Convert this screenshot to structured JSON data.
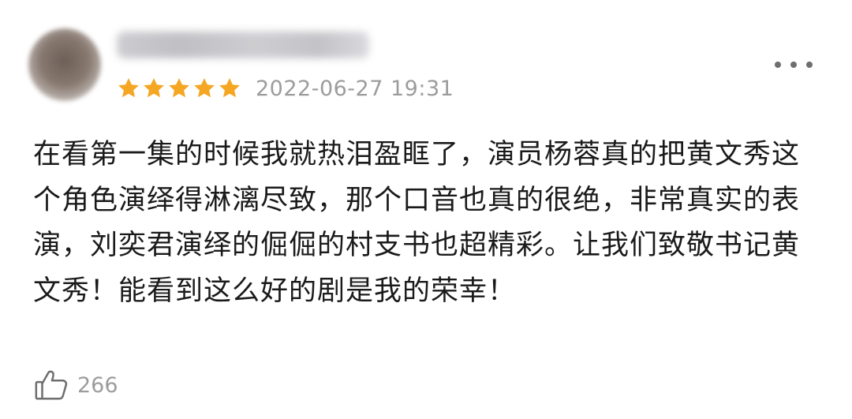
{
  "review": {
    "rating": 5,
    "rating_max": 5,
    "timestamp": "2022-06-27 19:31",
    "text": "在看第一集的时候我就热泪盈眶了，演员杨蓉真的把黄文秀这个角色演绎得淋漓尽致，那个口音也真的很绝，非常真实的表演，刘奕君演绎的倔倔的村支书也超精彩。让我们致敬书记黄文秀！能看到这么好的剧是我的荣幸！",
    "likes": "266"
  },
  "icons": {
    "star": "star-icon",
    "more": "more-options-icon",
    "like": "thumbs-up-icon"
  },
  "colors": {
    "star": "#F5A623",
    "meta_text": "#9C9C9C",
    "body_text": "#1A1A1A",
    "icon_gray": "#6E6E6E"
  }
}
